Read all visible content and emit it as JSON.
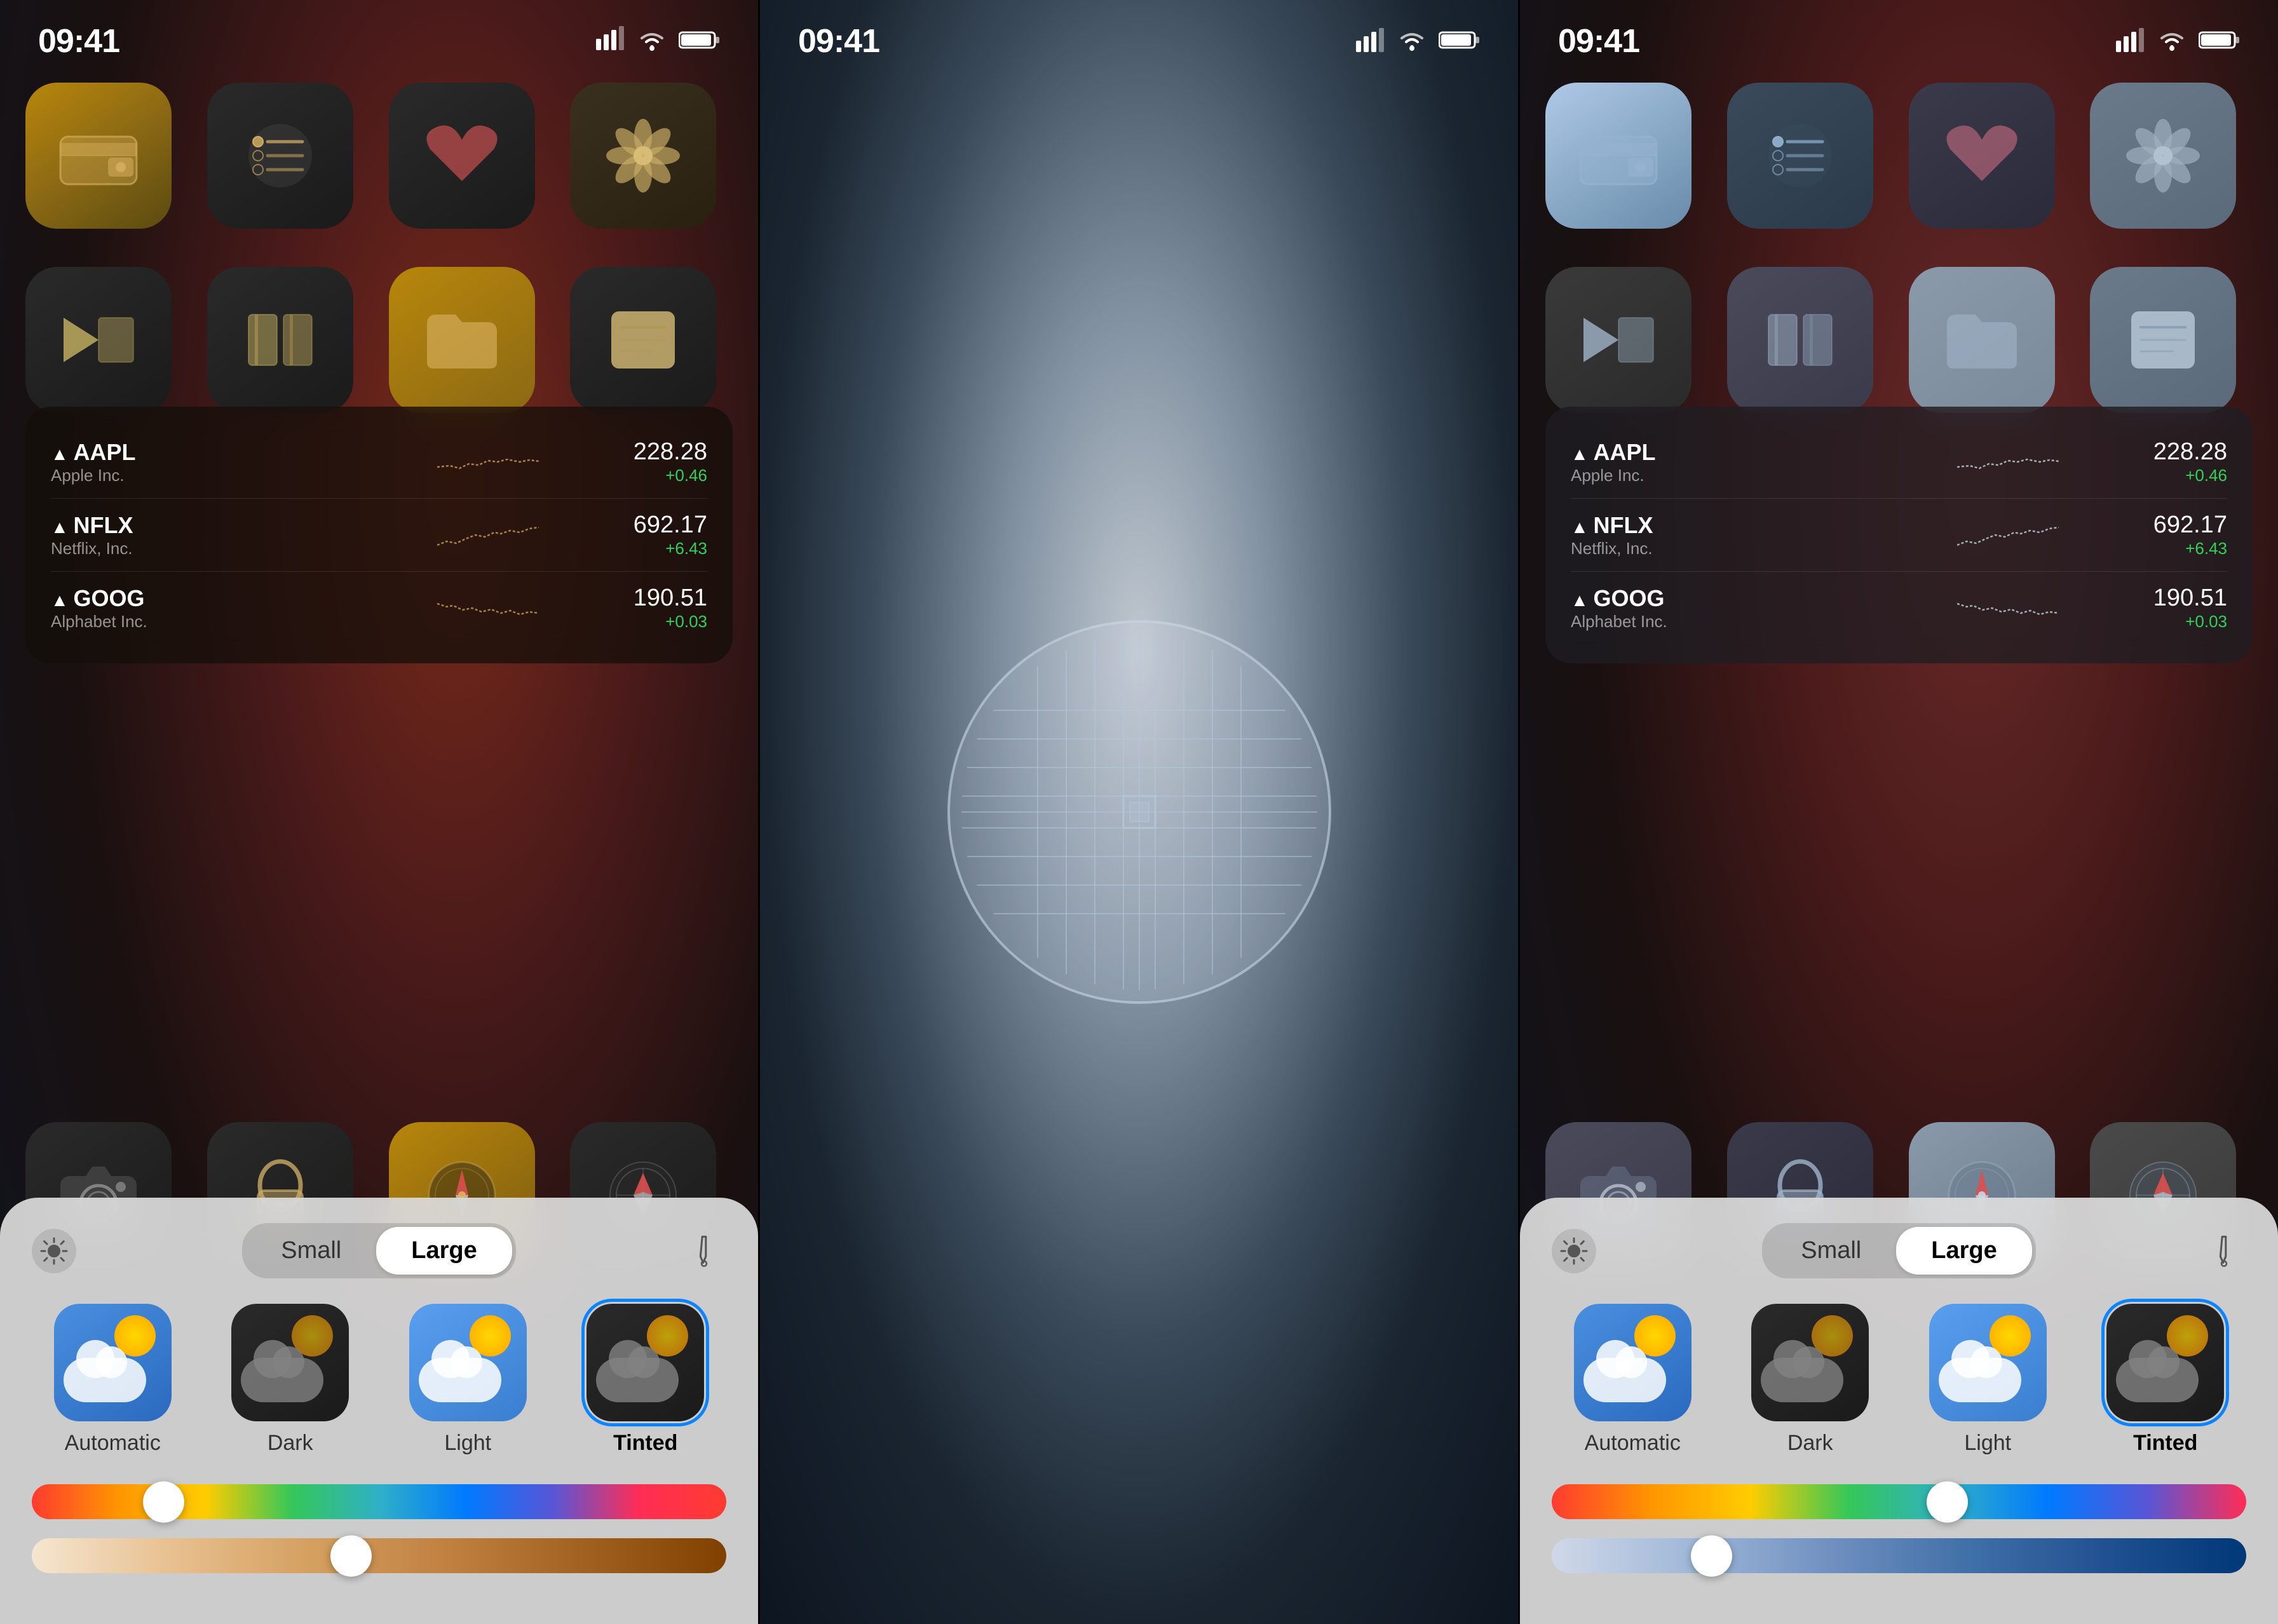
{
  "panel1": {
    "status": {
      "time": "09:41",
      "signal": "●●●",
      "wifi": "wifi",
      "battery": "battery"
    },
    "apps_row1": [
      {
        "name": "Wallet",
        "type": "wallet"
      },
      {
        "name": "Reminders",
        "type": "reminders"
      },
      {
        "name": "Health",
        "type": "health"
      },
      {
        "name": "Floral",
        "type": "floral"
      }
    ],
    "apps_row2": [
      {
        "name": "News",
        "type": "news"
      },
      {
        "name": "Books",
        "type": "books"
      },
      {
        "name": "Files",
        "type": "files"
      },
      {
        "name": "Notes",
        "type": "notes"
      }
    ],
    "stocks": [
      {
        "ticker": "AAPL",
        "name": "Apple Inc.",
        "value": "228.28",
        "change": "+0.46"
      },
      {
        "ticker": "NFLX",
        "name": "Netflix, Inc.",
        "value": "692.17",
        "change": "+6.43"
      },
      {
        "ticker": "GOOG",
        "name": "Alphabet Inc.",
        "value": "190.51",
        "change": "+0.03"
      }
    ],
    "bottom_apps": [
      {
        "name": "Camera",
        "type": "camera"
      },
      {
        "name": "Passwords",
        "type": "passwords"
      },
      {
        "name": "Maps",
        "type": "compass"
      },
      {
        "name": "Safari",
        "type": "safari"
      }
    ],
    "control": {
      "size_small": "Small",
      "size_large": "Large",
      "appearances": [
        {
          "label": "Automatic",
          "type": "automatic",
          "selected": false
        },
        {
          "label": "Dark",
          "type": "dark",
          "selected": false
        },
        {
          "label": "Light",
          "type": "light",
          "selected": false
        },
        {
          "label": "Tinted",
          "type": "tinted_warm",
          "selected": true
        }
      ],
      "slider_color_position_warm": "18%",
      "slider_intensity_position_warm": "45%"
    }
  },
  "panel2": {
    "status": {
      "time": "09:41"
    }
  },
  "panel3": {
    "status": {
      "time": "09:41"
    },
    "control": {
      "size_small": "Small",
      "size_large": "Large",
      "appearances": [
        {
          "label": "Automatic",
          "type": "automatic",
          "selected": false
        },
        {
          "label": "Dark",
          "type": "dark",
          "selected": false
        },
        {
          "label": "Light",
          "type": "light",
          "selected": false
        },
        {
          "label": "Tinted",
          "type": "tinted_blue",
          "selected": true
        }
      ],
      "slider_color_position_blue": "56%",
      "slider_intensity_position_blue": "22%"
    }
  }
}
